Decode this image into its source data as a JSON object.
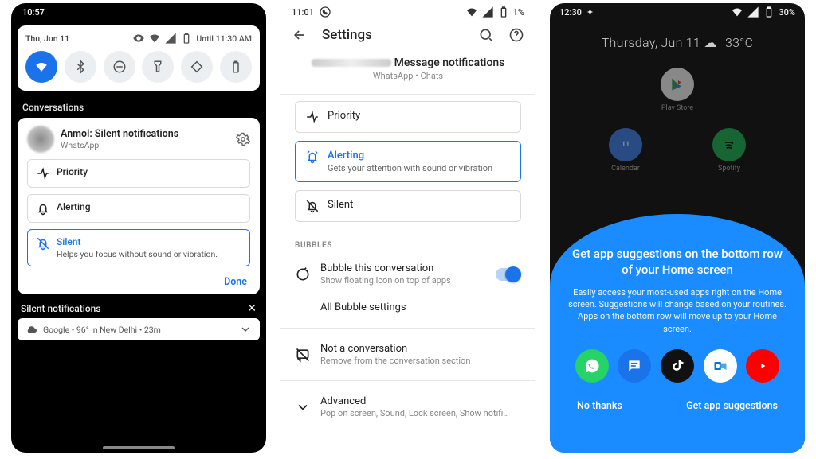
{
  "phone1": {
    "time": "10:57",
    "qs_date": "Thu, Jun 11",
    "qs_alarm": "Until 11:30 AM",
    "tiles": [
      "wifi-icon",
      "bluetooth-icon",
      "dnd-icon",
      "flashlight-icon",
      "autorotate-icon",
      "battery-saver-icon"
    ],
    "conversations_label": "Conversations",
    "noti_title": "Anmol: Silent notifications",
    "noti_app": "WhatsApp",
    "opt_priority": "Priority",
    "opt_alerting": "Alerting",
    "opt_silent": "Silent",
    "opt_silent_desc": "Helps you focus without sound or vibration.",
    "done": "Done",
    "silent_header": "Silent notifications",
    "weather": "Google • 96° in New Delhi • 23m"
  },
  "phone2": {
    "time": "11:01",
    "battery": "1%",
    "header": "Settings",
    "sub_title": "Message notifications",
    "sub_app": "WhatsApp • Chats",
    "opt_priority": "Priority",
    "opt_alerting": "Alerting",
    "opt_alerting_desc": "Gets your attention with sound or vibration",
    "opt_silent": "Silent",
    "bubbles_header": "BUBBLES",
    "bubble_row": "Bubble this conversation",
    "bubble_row_sub": "Show floating icon on top of apps",
    "all_bubble": "All Bubble settings",
    "notconv": "Not a conversation",
    "notconv_sub": "Remove from the conversation section",
    "advanced": "Advanced",
    "advanced_sub": "Pop on screen, Sound, Lock screen, Show notifi…"
  },
  "phone3": {
    "time": "12:30",
    "battery": "30%",
    "date": "Thursday, Jun 11",
    "temp": "33°C",
    "dim_apps": [
      {
        "name": "Play Store",
        "color": "#fff"
      },
      {
        "name": "Calendar",
        "color": "#4285f4"
      },
      {
        "name": "Spotify",
        "color": "#1db954"
      }
    ],
    "sheet_heading": "Get app suggestions on the bottom row of your Home screen",
    "sheet_body": "Easily access your most-used apps right on the Home screen. Suggestions will change based on your routines. Apps on the bottom row will move up to your Home screen.",
    "sugg_icons": [
      {
        "name": "whatsapp-icon",
        "bg": "#25d366"
      },
      {
        "name": "messages-icon",
        "bg": "#1a73e8"
      },
      {
        "name": "tiktok-icon",
        "bg": "#111"
      },
      {
        "name": "outlook-icon",
        "bg": "#fff"
      },
      {
        "name": "youtube-icon",
        "bg": "#ff0000"
      }
    ],
    "no_thanks": "No thanks",
    "get_suggestions": "Get app suggestions"
  }
}
